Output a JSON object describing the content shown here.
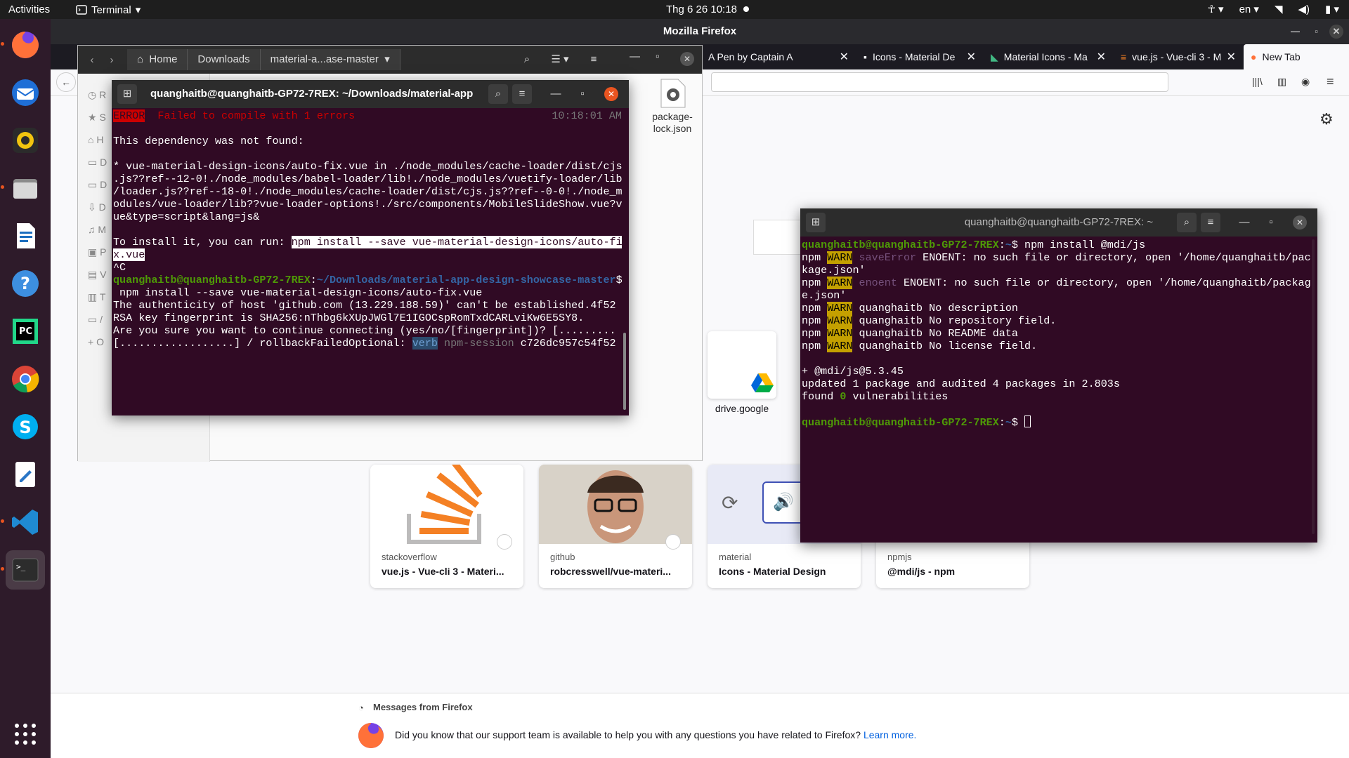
{
  "topbar": {
    "activities": "Activities",
    "app": "Terminal",
    "clock": "Thg 6 26  10:18",
    "lang": "en"
  },
  "firefox": {
    "title": "Mozilla Firefox",
    "tabs": [
      {
        "label": "A Pen by Captain A"
      },
      {
        "label": "Icons - Material De"
      },
      {
        "label": "Material Icons - Ma"
      },
      {
        "label": "vue.js - Vue-cli 3 - M"
      },
      {
        "label": "New Tab"
      }
    ],
    "tiles": [
      {
        "source": "stackoverflow",
        "title": "vue.js - Vue-cli 3 - Materi..."
      },
      {
        "source": "github",
        "title": "robcresswell/vue-materi..."
      },
      {
        "source": "material",
        "title": "Icons - Material Design"
      },
      {
        "source": "npmjs",
        "title": "@mdi/js - npm"
      }
    ],
    "top_site": "drive.google",
    "messages": {
      "header": "Messages from Firefox",
      "text": "Did you know that our support team is available to help you with any questions you have related to Firefox?",
      "link": "Learn more."
    }
  },
  "nautilus": {
    "crumbs": [
      "Home",
      "Downloads",
      "material-a...ase-master"
    ],
    "file": {
      "name": "package-lock.json",
      "name1": "package-",
      "name2": "lock.json"
    },
    "side_letters": [
      "R",
      "S",
      "H",
      "D",
      "D",
      "D",
      "M",
      "P",
      "V",
      "T",
      "/",
      "O"
    ]
  },
  "term1": {
    "title": "quanghaitb@quanghaitb-GP72-7REX: ~/Downloads/material-app...",
    "error_tag": "ERROR",
    "error_msg": "Failed to compile with 1 errors",
    "error_time": "10:18:01 AM",
    "l_notfound": "This dependency was not found:",
    "l_dep1": "* vue-material-design-icons/auto-fix.vue in ./node_modules/cache-loader/dist/cjs",
    "l_dep2": ".js??ref--12-0!./node_modules/babel-loader/lib!./node_modules/vuetify-loader/lib",
    "l_dep3": "/loader.js??ref--18-0!./node_modules/cache-loader/dist/cjs.js??ref--0-0!./node_m",
    "l_dep4": "odules/vue-loader/lib??vue-loader-options!./src/components/MobileSlideShow.vue?v",
    "l_dep5": "ue&type=script&lang=js&",
    "l_install": "To install it, you can run: ",
    "l_cmd1": "npm install --save vue-material-design-icons/auto-fi",
    "l_cmd2": "x.vue",
    "l_ctrlc": "^C",
    "prompt_user": "quanghaitb@quanghaitb-GP72-7REX",
    "prompt_path": "~/Downloads/material-app-design-showcase-master",
    "l_typed": " npm install --save vue-material-design-icons/auto-fix.vue",
    "l_auth": "The authenticity of host 'github.com (13.229.188.59)' can't be established.4f52",
    "l_rsa": "RSA key fingerprint is SHA256:nThbg6kXUpJWGl7E1IGOCspRomTxdCARLviKw6E5SY8.",
    "l_sure": "Are you sure you want to continue connecting (yes/no/[fingerprint])? [.........",
    "l_prog": "[..................] / rollbackFailedOptional: ",
    "l_verb": "verb",
    "l_sess": " npm-session",
    "l_sessid": " c726dc957c54f52"
  },
  "term2": {
    "title": "quanghaitb@quanghaitb-GP72-7REX: ~",
    "prompt_user": "quanghaitb@quanghaitb-GP72-7REX",
    "prompt_path": "~",
    "cmd": " npm install @mdi/js",
    "warn": "WARN",
    "npm": "npm",
    "w1_key": "saveError",
    "w1a": " ENOENT: no such file or directory, open '/home/quanghaitb/pac",
    "w1b": "kage.json'",
    "w2_key": "enoent",
    "w2a": " ENOENT: no such file or directory, open '/home/quanghaitb/package",
    "w2b": "e.json'",
    "w3": " quanghaitb No description",
    "w4": " quanghaitb No repository field.",
    "w5": " quanghaitb No README data",
    "w6": " quanghaitb No license field.",
    "added": "+ @mdi/js@5.3.45",
    "updated": "updated 1 package and audited 4 packages in 2.803s",
    "found_pre": "found ",
    "found_n": "0",
    "found_post": " vulnerabilities"
  },
  "colors": {
    "ubuntu_orange": "#e95420",
    "terminal_bg": "#300a24",
    "prompt_green": "#4e9a06",
    "prompt_blue": "#3465a4",
    "warn_bg": "#c4a000"
  }
}
